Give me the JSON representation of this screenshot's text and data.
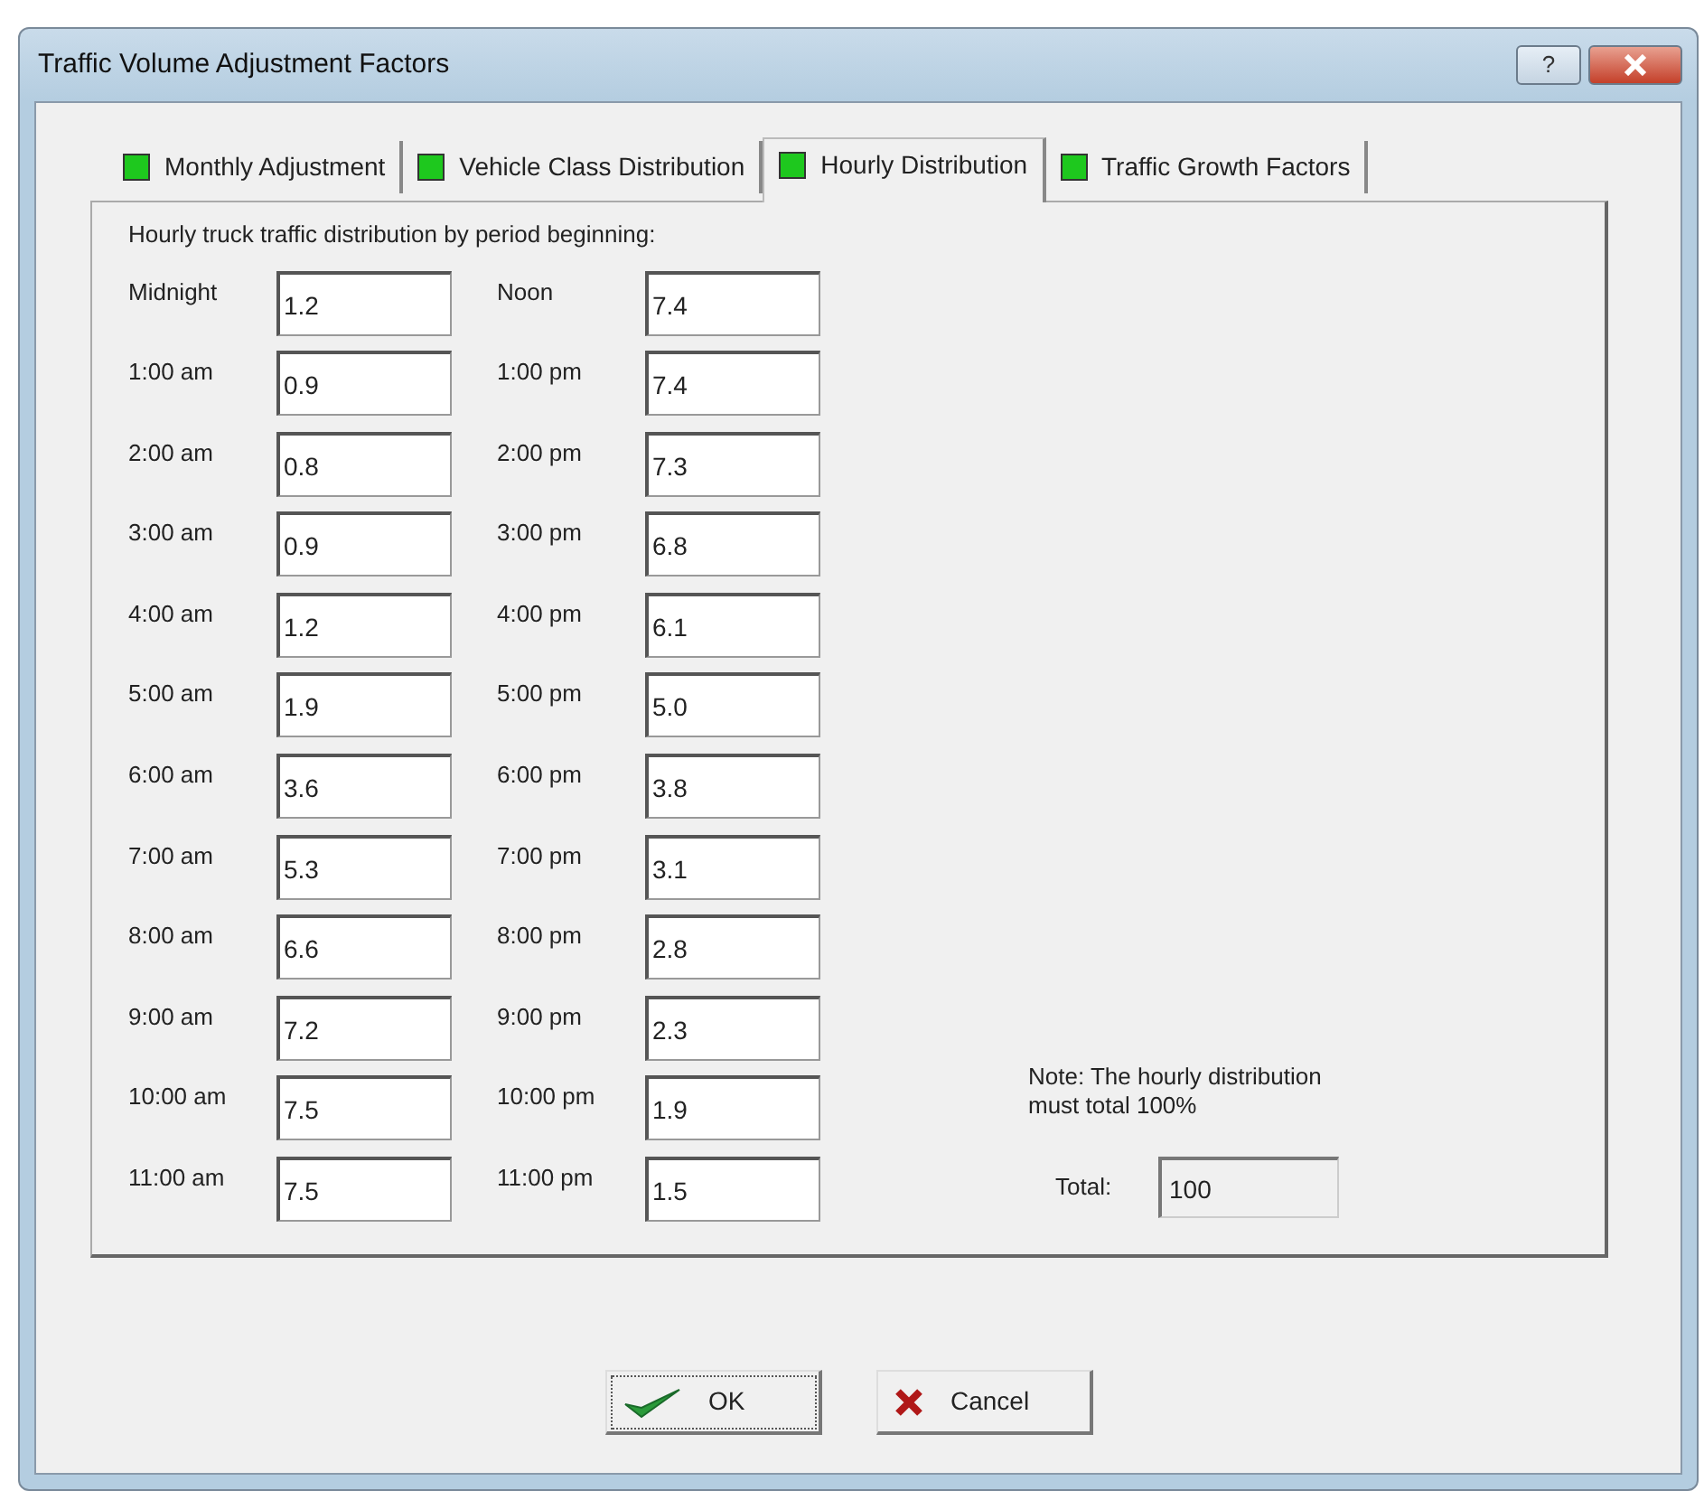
{
  "window": {
    "title": "Traffic Volume Adjustment Factors",
    "help_button": "?"
  },
  "tabs": [
    {
      "label": "Monthly Adjustment",
      "selected": false
    },
    {
      "label": "Vehicle Class Distribution",
      "selected": false
    },
    {
      "label": "Hourly Distribution",
      "selected": true
    },
    {
      "label": "Traffic Growth Factors",
      "selected": false
    }
  ],
  "heading": "Hourly truck traffic distribution by period beginning:",
  "columns": [
    [
      {
        "label": "Midnight",
        "value": "1.2"
      },
      {
        "label": "1:00 am",
        "value": "0.9"
      },
      {
        "label": "2:00 am",
        "value": "0.8"
      },
      {
        "label": "3:00 am",
        "value": "0.9"
      },
      {
        "label": "4:00 am",
        "value": "1.2"
      },
      {
        "label": "5:00 am",
        "value": "1.9"
      },
      {
        "label": "6:00 am",
        "value": "3.6"
      },
      {
        "label": "7:00 am",
        "value": "5.3"
      },
      {
        "label": "8:00 am",
        "value": "6.6"
      },
      {
        "label": "9:00 am",
        "value": "7.2"
      },
      {
        "label": "10:00 am",
        "value": "7.5"
      },
      {
        "label": "11:00 am",
        "value": "7.5"
      }
    ],
    [
      {
        "label": "Noon",
        "value": "7.4"
      },
      {
        "label": "1:00 pm",
        "value": "7.4"
      },
      {
        "label": "2:00 pm",
        "value": "7.3"
      },
      {
        "label": "3:00 pm",
        "value": "6.8"
      },
      {
        "label": "4:00 pm",
        "value": "6.1"
      },
      {
        "label": "5:00 pm",
        "value": "5.0"
      },
      {
        "label": "6:00 pm",
        "value": "3.8"
      },
      {
        "label": "7:00 pm",
        "value": "3.1"
      },
      {
        "label": "8:00 pm",
        "value": "2.8"
      },
      {
        "label": "9:00 pm",
        "value": "2.3"
      },
      {
        "label": "10:00 pm",
        "value": "1.9"
      },
      {
        "label": "11:00 pm",
        "value": "1.5"
      }
    ]
  ],
  "note": "Note: The hourly distribution must total 100%",
  "total": {
    "label": "Total:",
    "value": "100",
    "disabled": true
  },
  "buttons": [
    {
      "kind": "ok",
      "label": "OK"
    },
    {
      "kind": "cancel",
      "label": "Cancel"
    }
  ]
}
